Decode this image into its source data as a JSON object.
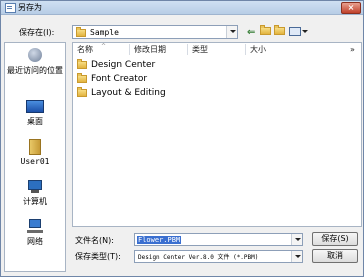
{
  "window": {
    "title": "另存为",
    "close_label": "×"
  },
  "location": {
    "label": "保存在(I):",
    "value": "Sample"
  },
  "toolbar": {
    "back_icon": "back-arrow-icon",
    "up_icon": "up-folder-icon",
    "new_folder_icon": "new-folder-icon",
    "view_icon": "view-menu-icon"
  },
  "sidebar": {
    "items": [
      {
        "label": "最近访问的位置",
        "icon": "recent-places-icon"
      },
      {
        "label": "桌面",
        "icon": "desktop-icon"
      },
      {
        "label": "User01",
        "icon": "user-folder-icon"
      },
      {
        "label": "计算机",
        "icon": "computer-icon"
      },
      {
        "label": "网络",
        "icon": "network-icon"
      }
    ]
  },
  "list": {
    "columns": [
      "名称",
      "修改日期",
      "类型",
      "大小"
    ],
    "more": "»",
    "items": [
      "Design Center",
      "Font Creator",
      "Layout & Editing"
    ]
  },
  "filename": {
    "label": "文件名(N):",
    "value": "Flower.PBM"
  },
  "filetype": {
    "label": "保存类型(T):",
    "value": "Design Center Ver.8.0 文件 (*.PBM)"
  },
  "buttons": {
    "save": "保存(S)",
    "cancel": "取消"
  }
}
